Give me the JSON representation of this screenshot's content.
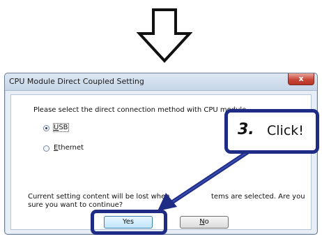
{
  "dialog": {
    "title": "CPU Module Direct Coupled Setting",
    "close_label": "x",
    "prompt": "Please select the direct connection method with CPU module.",
    "options": [
      {
        "label_first": "U",
        "label_rest": "SB",
        "checked": true
      },
      {
        "label_first": "E",
        "label_rest": "thernet",
        "checked": false
      }
    ],
    "warning_line1": "Current setting content will be lost when",
    "warning_line1_end": "tems are selected. Are you",
    "warning_line2": "sure you want to continue?",
    "yes_label": "Yes",
    "no_first": "N",
    "no_rest": "o"
  },
  "callout": {
    "step": "3.",
    "text": "Click!"
  },
  "icons": [
    "down-arrow-icon",
    "pointer-arrow-icon",
    "close-icon",
    "radio-icon"
  ],
  "colors": {
    "annotation": "#1f2c86",
    "dialog_bg": "#e8eef6",
    "close_red": "#c8483a"
  }
}
